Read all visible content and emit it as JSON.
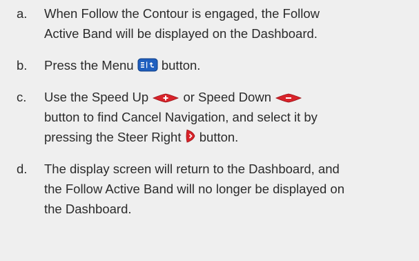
{
  "steps": [
    {
      "letter": "a.",
      "line1": "When Follow the Contour is engaged, the Follow",
      "line2": "Active Band will be displayed on the Dashboard."
    },
    {
      "letter": "b.",
      "text_before": "Press the Menu",
      "icon": "menu-button-icon",
      "text_after": "button."
    },
    {
      "letter": "c.",
      "text_before": "Use the Speed Up",
      "icon1": "speed-up-button-icon",
      "text_mid": "or Speed Down",
      "icon2": "speed-down-button-icon",
      "line2": "button to find Cancel Navigation, and select it by",
      "line3_before": "pressing the Steer Right",
      "icon3": "steer-right-button-icon",
      "line3_after": "button."
    },
    {
      "letter": "d.",
      "line1": "The display screen will return to the Dashboard, and",
      "line2": "the Follow Active Band will no longer be displayed on",
      "line3": "the Dashboard."
    }
  ],
  "colors": {
    "background": "#efefef",
    "text": "#2b2b2b",
    "menu_button": "#1f5fbf",
    "speed_button": "#d8232a",
    "steer_button": "#d8232a"
  }
}
